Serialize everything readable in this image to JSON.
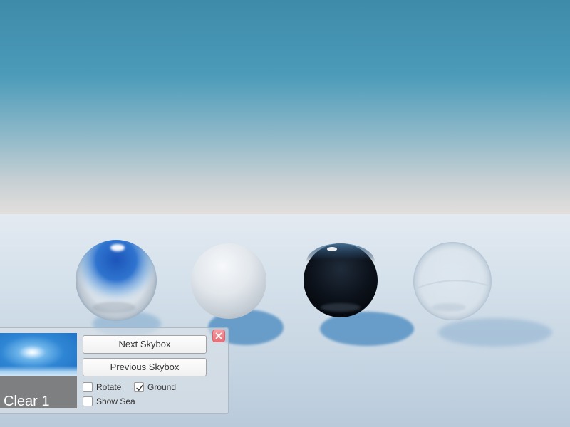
{
  "panel": {
    "preview": {
      "label": "Clear 1"
    },
    "buttons": {
      "next_label": "Next Skybox",
      "previous_label": "Previous Skybox"
    },
    "options": {
      "rotate": {
        "label": "Rotate",
        "checked": false
      },
      "ground": {
        "label": "Ground",
        "checked": true
      },
      "show_sea": {
        "label": "Show Sea",
        "checked": false
      }
    },
    "close_icon": "close-x-icon"
  },
  "scene": {
    "spheres": [
      "clear-glass",
      "matte-white",
      "glossy-black",
      "frosted-glass"
    ]
  },
  "colors": {
    "sky_top": "#3e8aa9",
    "horizon": "#e2dfdc",
    "ground": "#d5e1eb",
    "close_button": "#e86f78"
  }
}
